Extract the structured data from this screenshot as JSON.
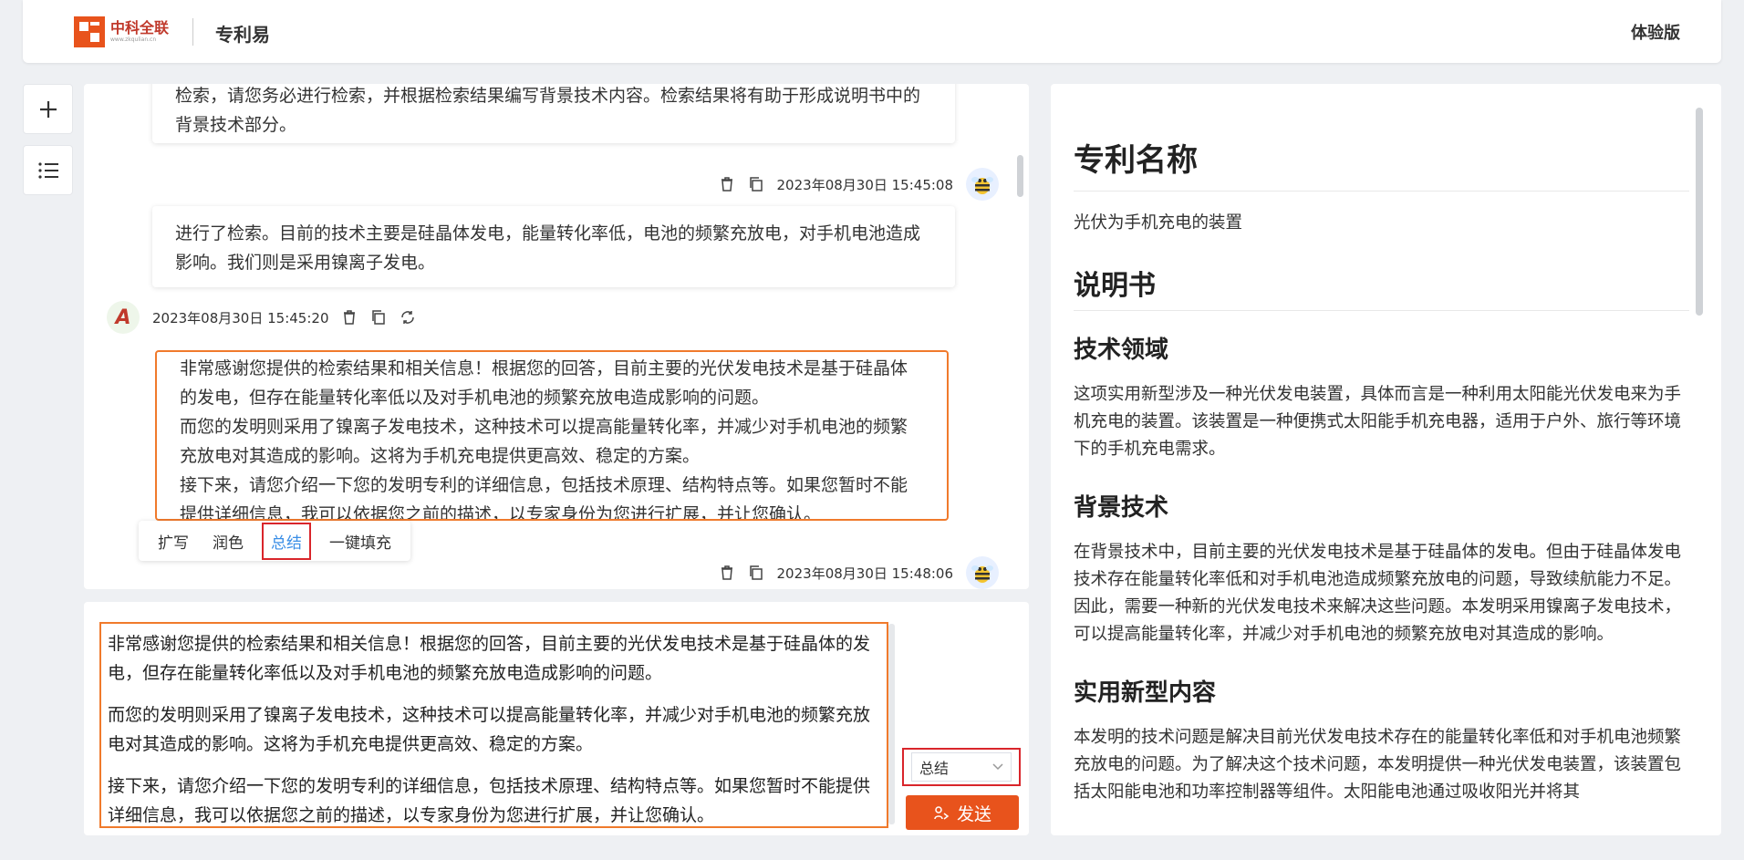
{
  "header": {
    "brand_name": "中科全联",
    "brand_sub": "www.zkqulian.cn",
    "app_title": "专利易",
    "edition": "体验版"
  },
  "sidebar": {
    "new_icon": "plus-icon",
    "list_icon": "list-icon"
  },
  "chat": {
    "messages": [
      {
        "role": "user",
        "text": "检索，请您务必进行检索，并根据检索结果编写背景技术内容。检索结果将有助于形成说明书中的背景技术部分。"
      },
      {
        "role": "user",
        "timestamp": "2023年08月30日 15:45:08",
        "text": "进行了检索。目前的技术主要是硅晶体发电，能量转化率低，电池的频繁充放电，对手机电池造成影响。我们则是采用镍离子发电。"
      },
      {
        "role": "assistant",
        "timestamp": "2023年08月30日 15:45:20",
        "paragraphs": [
          "非常感谢您提供的检索结果和相关信息！根据您的回答，目前主要的光伏发电技术是基于硅晶体的发电，但存在能量转化率低以及对手机电池的频繁充放电造成影响的问题。",
          "而您的发明则采用了镍离子发电技术，这种技术可以提高能量转化率，并减少对手机电池的频繁充放电对其造成的影响。这将为手机充电提供更高效、稳定的方案。",
          "接下来，请您介绍一下您的发明专利的详细信息，包括技术原理、结构特点等。如果您暂时不能提供详细信息，我可以依据您之前的描述，以专家身份为您进行扩展，并让您确认。"
        ]
      },
      {
        "role": "user",
        "timestamp": "2023年08月30日 15:48:06"
      }
    ],
    "toolbar": [
      "扩写",
      "润色",
      "总结",
      "一键填充"
    ],
    "toolbar_active": "总结"
  },
  "input": {
    "paragraphs": [
      "非常感谢您提供的检索结果和相关信息！根据您的回答，目前主要的光伏发电技术是基于硅晶体的发电，但存在能量转化率低以及对手机电池的频繁充放电造成影响的问题。",
      "而您的发明则采用了镍离子发电技术，这种技术可以提高能量转化率，并减少对手机电池的频繁充放电对其造成的影响。这将为手机充电提供更高效、稳定的方案。",
      "接下来，请您介绍一下您的发明专利的详细信息，包括技术原理、结构特点等。如果您暂时不能提供详细信息，我可以依据您之前的描述，以专家身份为您进行扩展，并让您确认。"
    ],
    "mode_selected": "总结",
    "send_label": "发送"
  },
  "document": {
    "title_heading": "专利名称",
    "title_text": "光伏为手机充电的装置",
    "spec_heading": "说明书",
    "sections": [
      {
        "heading": "技术领域",
        "text": "这项实用新型涉及一种光伏发电装置，具体而言是一种利用太阳能光伏发电来为手机充电的装置。该装置是一种便携式太阳能手机充电器，适用于户外、旅行等环境下的手机充电需求。"
      },
      {
        "heading": "背景技术",
        "text": "在背景技术中，目前主要的光伏发电技术是基于硅晶体的发电。但由于硅晶体发电技术存在能量转化率低和对手机电池造成频繁充放电的问题，导致续航能力不足。因此，需要一种新的光伏发电技术来解决这些问题。本发明采用镍离子发电技术，可以提高能量转化率，并减少对手机电池的频繁充放电对其造成的影响。"
      },
      {
        "heading": "实用新型内容",
        "text": "本发明的技术问题是解决目前光伏发电技术存在的能量转化率低和对手机电池频繁充放电的问题。为了解决这个技术问题，本发明提供一种光伏发电装置，该装置包括太阳能电池和功率控制器等组件。太阳能电池通过吸收阳光并将其"
      }
    ]
  },
  "colors": {
    "accent_orange": "#f07a2c",
    "send_button": "#e8531c",
    "highlight_red": "#d9252b",
    "active_blue": "#3a8ee6"
  }
}
